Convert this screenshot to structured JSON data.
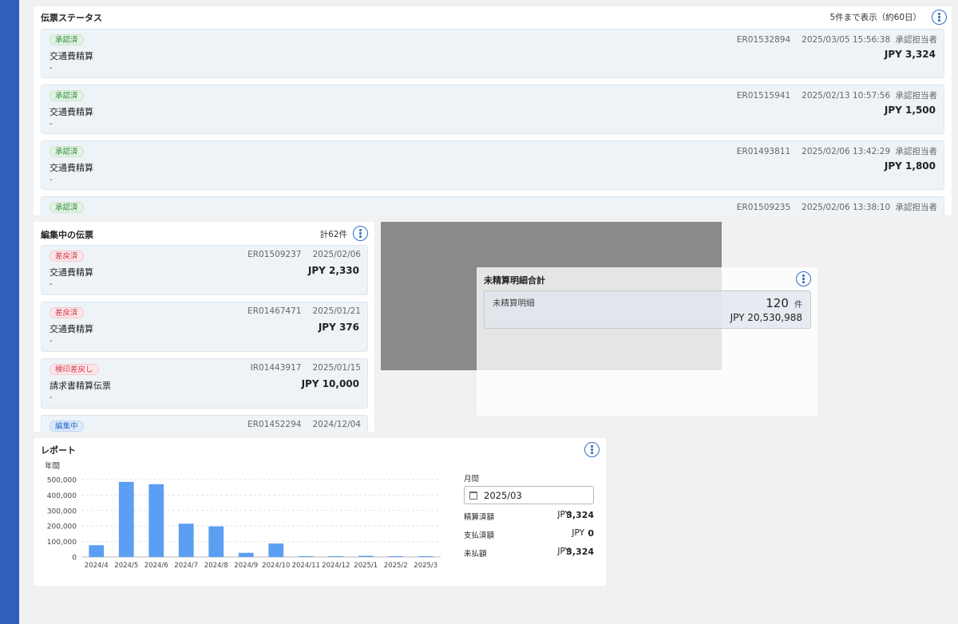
{
  "status_panel": {
    "title": "伝票ステータス",
    "display_note": "5件まで表示（約60日）",
    "cards": [
      {
        "badge": "承認済",
        "name": "交通費精算",
        "sub": "-",
        "id": "ER01532894",
        "datetime": "2025/03/05 15:56:38",
        "role": "承認担当者",
        "amount": "JPY 3,324"
      },
      {
        "badge": "承認済",
        "name": "交通費精算",
        "sub": "-",
        "id": "ER01515941",
        "datetime": "2025/02/13 10:57:56",
        "role": "承認担当者",
        "amount": "JPY 1,500"
      },
      {
        "badge": "承認済",
        "name": "交通費精算",
        "sub": "-",
        "id": "ER01493811",
        "datetime": "2025/02/06 13:42:29",
        "role": "承認担当者",
        "amount": "JPY 1,800"
      },
      {
        "badge": "承認済",
        "name": "",
        "sub": "",
        "id": "ER01509235",
        "datetime": "2025/02/06 13:38:10",
        "role": "承認担当者",
        "amount": ""
      }
    ]
  },
  "editing_panel": {
    "title": "編集中の伝票",
    "total": "計62件",
    "cards": [
      {
        "badge": "差戻済",
        "badge_color": "red",
        "name": "交通費精算",
        "sub": "-",
        "id": "ER01509237",
        "date": "2025/02/06",
        "amount": "JPY 2,330"
      },
      {
        "badge": "差戻済",
        "badge_color": "red",
        "name": "交通費精算",
        "sub": "-",
        "id": "ER01467471",
        "date": "2025/01/21",
        "amount": "JPY 376"
      },
      {
        "badge": "検印差戻し",
        "badge_color": "red",
        "name": "請求書精算伝票",
        "sub": "-",
        "id": "IR01443917",
        "date": "2025/01/15",
        "amount": "JPY 10,000"
      },
      {
        "badge": "編集中",
        "badge_color": "blue",
        "name": "",
        "sub": "",
        "id": "ER01452294",
        "date": "2024/12/04",
        "amount": ""
      }
    ]
  },
  "unsettled_panel": {
    "title": "未精算明細合計",
    "card_label": "未精算明細",
    "count": "120",
    "count_unit": "件",
    "amount": "JPY 20,530,988"
  },
  "report_panel": {
    "title": "レポート",
    "chart_caption": "年間",
    "month_label": "月間",
    "month_value": "2025/03",
    "rows": [
      {
        "label": "精算済額",
        "currency": "JPY",
        "value": "3,324"
      },
      {
        "label": "支払済額",
        "currency": "JPY",
        "value": "0"
      },
      {
        "label": "未払額",
        "currency": "JPY",
        "value": "3,324"
      }
    ]
  },
  "colors": {
    "sidebar": "#2f5fbd",
    "accent": "#2d6fc4",
    "bar": "#5b9ef2",
    "approved_badge": "#2e8b3a",
    "returned_badge": "#d23a4c"
  },
  "chart_data": {
    "type": "bar",
    "title": "",
    "xlabel": "",
    "ylabel": "",
    "categories": [
      "2024/4",
      "2024/5",
      "2024/6",
      "2024/7",
      "2024/8",
      "2024/9",
      "2024/10",
      "2024/11",
      "2024/12",
      "2025/1",
      "2025/2",
      "2025/3"
    ],
    "values": [
      76000,
      485000,
      470000,
      215000,
      198000,
      27000,
      87000,
      3000,
      4500,
      7500,
      3000,
      3324
    ],
    "ylim": [
      0,
      500000
    ],
    "yticks": [
      "0",
      "100,000",
      "200,000",
      "300,000",
      "400,000",
      "500,000"
    ],
    "grid": true
  }
}
